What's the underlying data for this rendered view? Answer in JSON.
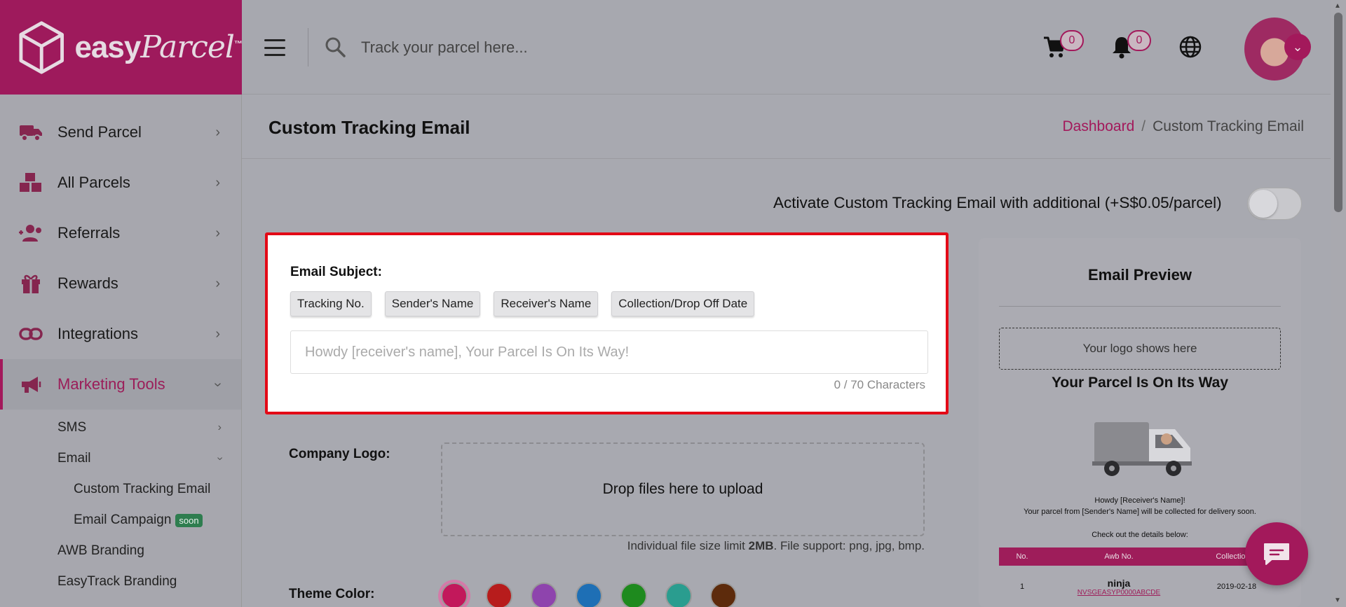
{
  "brand": {
    "name": "easy",
    "name_script": "Parcel",
    "tm": "™"
  },
  "sidebar": {
    "items": [
      {
        "label": "Send Parcel",
        "icon": "truck-icon"
      },
      {
        "label": "All Parcels",
        "icon": "boxes-icon"
      },
      {
        "label": "Referrals",
        "icon": "users-plus-icon"
      },
      {
        "label": "Rewards",
        "icon": "gift-icon"
      },
      {
        "label": "Integrations",
        "icon": "link-icon"
      },
      {
        "label": "Marketing Tools",
        "icon": "megaphone-icon"
      }
    ],
    "sub_items": {
      "sms": "SMS",
      "email": "Email",
      "custom_tracking": "Custom Tracking Email",
      "email_campaign": "Email Campaign",
      "soon_badge": "soon",
      "awb_branding": "AWB Branding",
      "easytrack_branding": "EasyTrack Branding"
    }
  },
  "header": {
    "search_placeholder": "Track your parcel here...",
    "cart_count": "0",
    "notification_count": "0"
  },
  "page": {
    "title": "Custom Tracking Email",
    "breadcrumb": {
      "home": "Dashboard",
      "current": "Custom Tracking Email",
      "separator": "/"
    },
    "activate_text": "Activate Custom Tracking Email with additional (+S$0.05/parcel)",
    "activate_on": false
  },
  "subject": {
    "label": "Email Subject:",
    "chips": [
      "Tracking No.",
      "Sender's Name",
      "Receiver's Name",
      "Collection/Drop Off Date"
    ],
    "placeholder": "Howdy [receiver's name], Your Parcel Is On Its Way!",
    "value": "",
    "char_count": "0 / 70 Characters"
  },
  "logo": {
    "label": "Company Logo:",
    "dropzone_text": "Drop files here to upload",
    "limit_prefix": "Individual file size limit ",
    "limit_size": "2MB",
    "limit_suffix": ". File support: png, jpg, bmp."
  },
  "theme": {
    "label": "Theme Color:",
    "colors": [
      "#c2185b",
      "#b71c1c",
      "#8e44ad",
      "#1e6fb5",
      "#1e8a1e",
      "#2a9d8f",
      "#5d2b0c"
    ],
    "selected": 0
  },
  "preview": {
    "title": "Email Preview",
    "logo_slot": "Your logo shows here",
    "heading": "Your Parcel Is On Its Way",
    "line1": "Howdy [Receiver's Name]!",
    "line2": "Your parcel from [Sender's Name] will be collected for delivery soon.",
    "check": "Check out the details below:",
    "table": {
      "headers": [
        "No.",
        "Awb No.",
        "Collection D"
      ],
      "row": {
        "no": "1",
        "courier": "ninja",
        "awb": "NVSGEASYP0000ABCDE",
        "date": "2019-02-18"
      }
    }
  },
  "colors": {
    "brand": "#a3195b",
    "highlight": "#e30a17"
  }
}
